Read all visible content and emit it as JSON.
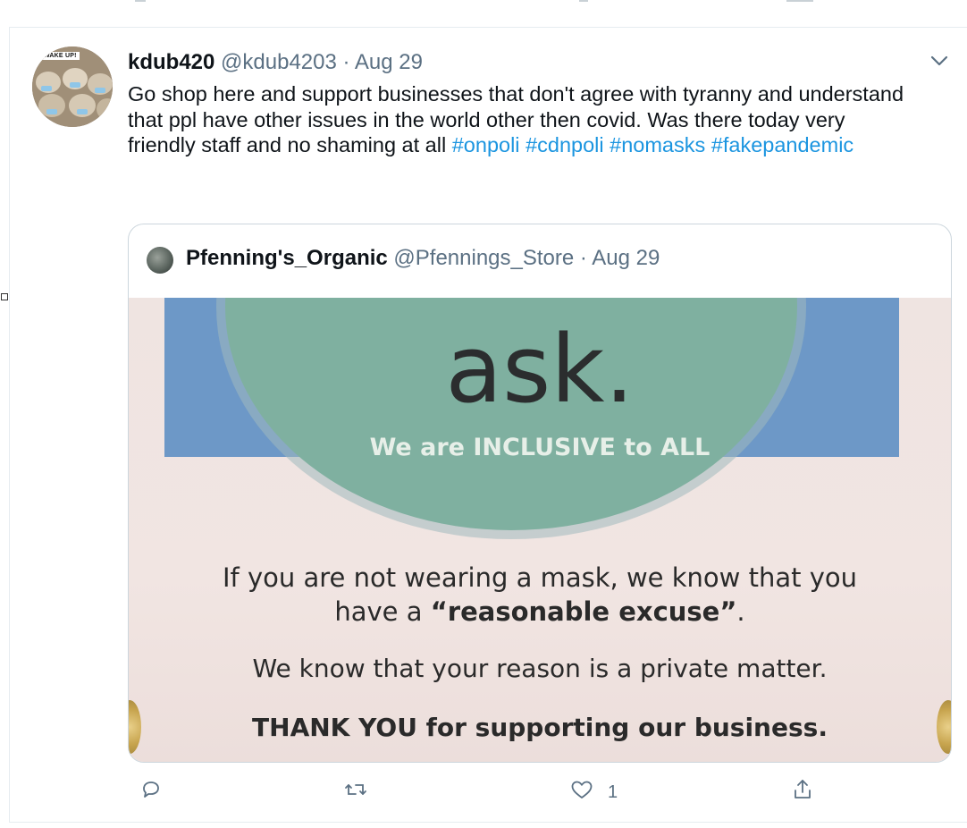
{
  "tweet": {
    "display_name": "kdub420",
    "handle": "@kdub4203",
    "separator": "·",
    "date": "Aug 29",
    "avatar_badge": "WAKE UP!",
    "text_parts": [
      {
        "type": "text",
        "value": "Go shop here and support businesses that don't agree with tyranny and understand that ppl have other issues in the world other then covid. Was there today very friendly staff and no shaming at all "
      },
      {
        "type": "hashtag",
        "value": "#onpoli"
      },
      {
        "type": "text",
        "value": " "
      },
      {
        "type": "hashtag",
        "value": "#cdnpoli"
      },
      {
        "type": "text",
        "value": " "
      },
      {
        "type": "hashtag",
        "value": "#nomasks"
      },
      {
        "type": "text",
        "value": " "
      },
      {
        "type": "hashtag",
        "value": "#fakepandemic"
      }
    ],
    "quoted": {
      "display_name": "Pfenning's_Organic",
      "handle": "@Pfennings_Store",
      "separator": "·",
      "date": "Aug 29",
      "sign": {
        "heading": "ask.",
        "inclusive": "We are INCLUSIVE to ALL",
        "line1": "If you are not wearing a mask, we know that you",
        "line2_prefix": "have a ",
        "line2_bold": "“reasonable excuse”",
        "line2_suffix": ".",
        "line3": "We know that your reason is a private matter.",
        "line4": "THANK YOU for supporting our business."
      }
    },
    "actions": {
      "reply_icon": "reply-icon",
      "retweet_icon": "retweet-icon",
      "like_icon": "heart-icon",
      "like_count": "1",
      "share_icon": "share-icon"
    }
  },
  "colors": {
    "hashtag": "#1b95e0",
    "meta": "#5b7083",
    "border": "#ccd6dd"
  }
}
